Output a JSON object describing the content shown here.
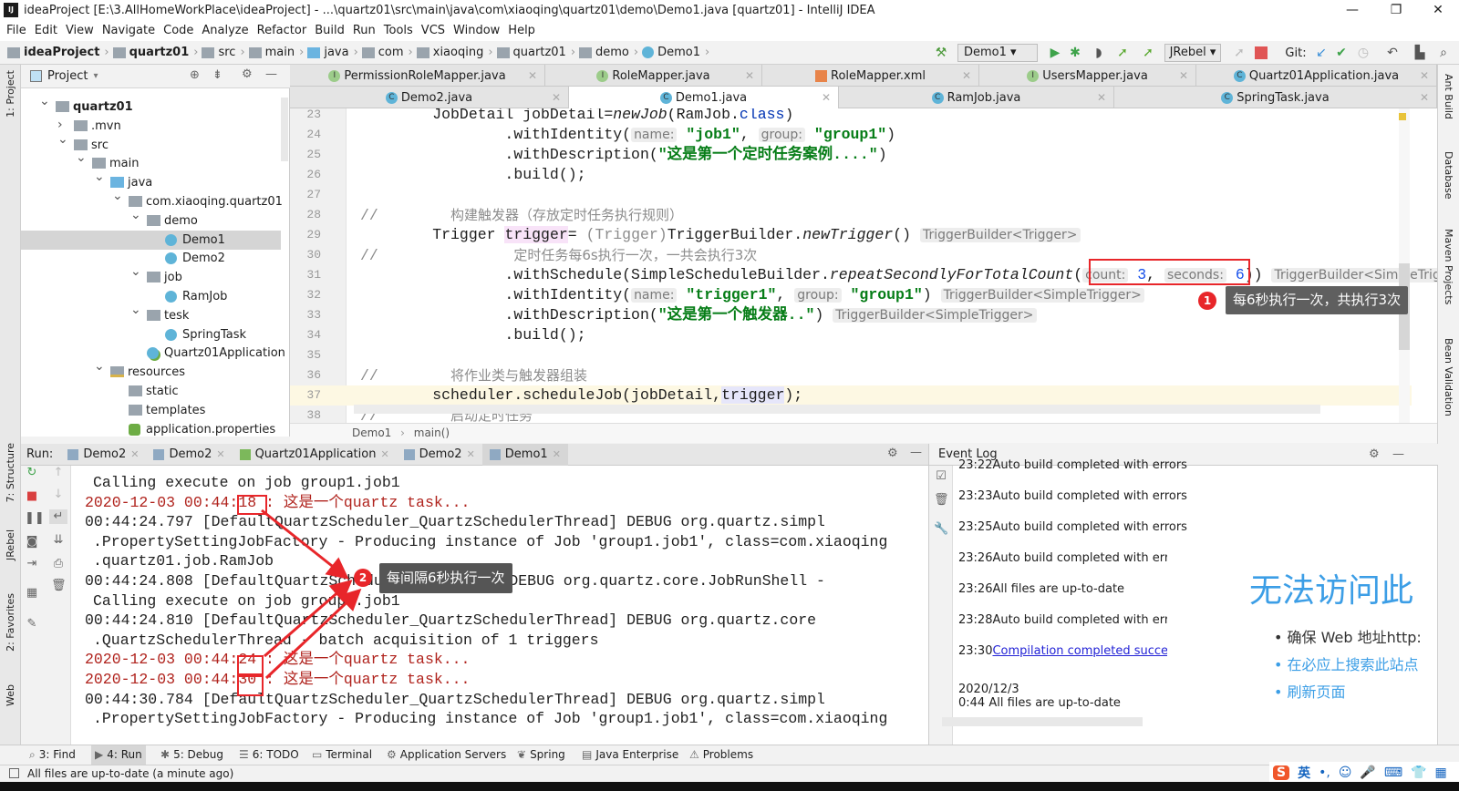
{
  "window": {
    "title": "ideaProject [E:\\3.AllHomeWorkPlace\\ideaProject] - ...\\quartz01\\src\\main\\java\\com\\xiaoqing\\quartz01\\demo\\Demo1.java [quartz01] - IntelliJ IDEA",
    "logo": "IJ",
    "minimize": "—",
    "maximize": "❐",
    "close": "✕"
  },
  "menu": [
    "File",
    "Edit",
    "View",
    "Navigate",
    "Code",
    "Analyze",
    "Refactor",
    "Build",
    "Run",
    "Tools",
    "VCS",
    "Window",
    "Help"
  ],
  "breadcrumb": [
    {
      "label": "ideaProject",
      "icon": "module",
      "bold": true
    },
    {
      "label": "quartz01",
      "icon": "module",
      "bold": true
    },
    {
      "label": "src",
      "icon": "folder"
    },
    {
      "label": "main",
      "icon": "folder"
    },
    {
      "label": "java",
      "icon": "source-folder"
    },
    {
      "label": "com",
      "icon": "package"
    },
    {
      "label": "xiaoqing",
      "icon": "package"
    },
    {
      "label": "quartz01",
      "icon": "package"
    },
    {
      "label": "demo",
      "icon": "package"
    },
    {
      "label": "Demo1",
      "icon": "class"
    }
  ],
  "toolbar": {
    "run_config": "Demo1",
    "jrebel": "JRebel",
    "git": "Git:"
  },
  "left_stripe": [
    "1: Project",
    "7: Structure",
    "JRebel",
    "2: Favorites",
    "Web"
  ],
  "right_stripe": [
    "Ant Build",
    "Database",
    "Maven Projects",
    "Bean Validation"
  ],
  "project": {
    "title": "Project",
    "tree": [
      {
        "label": "quartz01",
        "level": 0,
        "state": "expanded",
        "icon": "module",
        "bold": true
      },
      {
        "label": ".mvn",
        "level": 1,
        "state": "collapsed",
        "icon": "folder"
      },
      {
        "label": "src",
        "level": 1,
        "state": "expanded",
        "icon": "folder"
      },
      {
        "label": "main",
        "level": 2,
        "state": "expanded",
        "icon": "folder"
      },
      {
        "label": "java",
        "level": 3,
        "state": "expanded",
        "icon": "source-folder"
      },
      {
        "label": "com.xiaoqing.quartz01",
        "level": 4,
        "state": "expanded",
        "icon": "package"
      },
      {
        "label": "demo",
        "level": 5,
        "state": "expanded",
        "icon": "package"
      },
      {
        "label": "Demo1",
        "level": 6,
        "icon": "class",
        "selected": true
      },
      {
        "label": "Demo2",
        "level": 6,
        "icon": "class"
      },
      {
        "label": "job",
        "level": 5,
        "state": "expanded",
        "icon": "package"
      },
      {
        "label": "RamJob",
        "level": 6,
        "icon": "class"
      },
      {
        "label": "tesk",
        "level": 5,
        "state": "expanded",
        "icon": "package"
      },
      {
        "label": "SpringTask",
        "level": 6,
        "icon": "class"
      },
      {
        "label": "Quartz01Application",
        "level": 5,
        "icon": "spring-class"
      },
      {
        "label": "resources",
        "level": 3,
        "state": "expanded",
        "icon": "resources-folder"
      },
      {
        "label": "static",
        "level": 4,
        "icon": "folder"
      },
      {
        "label": "templates",
        "level": 4,
        "icon": "folder"
      },
      {
        "label": "application.properties",
        "level": 4,
        "icon": "properties"
      }
    ]
  },
  "editor_tabs_row1": [
    {
      "label": "PermissionRoleMapper.java",
      "icon": "I"
    },
    {
      "label": "RoleMapper.java",
      "icon": "I"
    },
    {
      "label": "RoleMapper.xml",
      "icon": "xml"
    },
    {
      "label": "UsersMapper.java",
      "icon": "I"
    },
    {
      "label": "Quartz01Application.java",
      "icon": "C"
    }
  ],
  "editor_tabs_row2": [
    {
      "label": "Demo2.java",
      "icon": "C"
    },
    {
      "label": "Demo1.java",
      "icon": "C",
      "active": true
    },
    {
      "label": "RamJob.java",
      "icon": "C"
    },
    {
      "label": "SpringTask.java",
      "icon": "C"
    }
  ],
  "code_lines": [
    {
      "n": "23",
      "tokens": [
        {
          "t": "        JobDetail jobDetail="
        },
        {
          "t": "newJob",
          "c": "it"
        },
        {
          "t": "(RamJob."
        },
        {
          "t": "class",
          "c": "kw"
        },
        {
          "t": ")"
        }
      ]
    },
    {
      "n": "24",
      "tokens": [
        {
          "t": "                .withIdentity("
        },
        {
          "t": "name:",
          "c": "hint"
        },
        {
          "t": " "
        },
        {
          "t": "\"job1\"",
          "c": "str"
        },
        {
          "t": ", "
        },
        {
          "t": "group:",
          "c": "hint"
        },
        {
          "t": " "
        },
        {
          "t": "\"group1\"",
          "c": "str"
        },
        {
          "t": ")"
        }
      ]
    },
    {
      "n": "25",
      "tokens": [
        {
          "t": "                .withDescription("
        },
        {
          "t": "\"这是第一个定时任务案例....\"",
          "c": "str"
        },
        {
          "t": ")"
        }
      ]
    },
    {
      "n": "26",
      "tokens": [
        {
          "t": "                .build();"
        }
      ]
    },
    {
      "n": "27",
      "tokens": []
    },
    {
      "n": "28",
      "tokens": [
        {
          "t": "//",
          "c": "cmm"
        },
        {
          "t": "        "
        },
        {
          "t": "构建触发器（存放定时任务执行规则）",
          "c": "cm"
        }
      ]
    },
    {
      "n": "29",
      "tokens": [
        {
          "t": "        Trigger "
        },
        {
          "t": "trigger",
          "c": "hl1"
        },
        {
          "t": "= "
        },
        {
          "t": "(Trigger)",
          "c": "gray"
        },
        {
          "t": "TriggerBuilder."
        },
        {
          "t": "newTrigger",
          "c": "it"
        },
        {
          "t": "() "
        },
        {
          "t": "TriggerBuilder<Trigger>",
          "c": "hint"
        }
      ]
    },
    {
      "n": "30",
      "tokens": [
        {
          "t": "//",
          "c": "cmm"
        },
        {
          "t": "               "
        },
        {
          "t": "定时任务每6s执行一次，一共会执行3次",
          "c": "cm"
        }
      ]
    },
    {
      "n": "31",
      "tokens": [
        {
          "t": "                .withSchedule(SimpleScheduleBuilder."
        },
        {
          "t": "repeatSecondlyForTotalCount",
          "c": "it"
        },
        {
          "t": "("
        },
        {
          "t": "count:",
          "c": "hint"
        },
        {
          "t": " "
        },
        {
          "t": "3",
          "c": "num"
        },
        {
          "t": ", "
        },
        {
          "t": "seconds:",
          "c": "hint"
        },
        {
          "t": " "
        },
        {
          "t": "6",
          "c": "num"
        },
        {
          "t": ")) "
        },
        {
          "t": "TriggerBuilder<SimpleTrigger>",
          "c": "hint"
        }
      ]
    },
    {
      "n": "32",
      "tokens": [
        {
          "t": "                .withIdentity("
        },
        {
          "t": "name:",
          "c": "hint"
        },
        {
          "t": " "
        },
        {
          "t": "\"trigger1\"",
          "c": "str"
        },
        {
          "t": ", "
        },
        {
          "t": "group:",
          "c": "hint"
        },
        {
          "t": " "
        },
        {
          "t": "\"group1\"",
          "c": "str"
        },
        {
          "t": ") "
        },
        {
          "t": "TriggerBuilder<SimpleTrigger>",
          "c": "hint"
        }
      ]
    },
    {
      "n": "33",
      "tokens": [
        {
          "t": "                .withDescription("
        },
        {
          "t": "\"这是第一个触发器..\"",
          "c": "str"
        },
        {
          "t": ") "
        },
        {
          "t": "TriggerBuilder<SimpleTrigger>",
          "c": "hint"
        }
      ]
    },
    {
      "n": "34",
      "tokens": [
        {
          "t": "                .build();"
        }
      ]
    },
    {
      "n": "35",
      "tokens": []
    },
    {
      "n": "36",
      "tokens": [
        {
          "t": "//",
          "c": "cmm"
        },
        {
          "t": "        "
        },
        {
          "t": "将作业类与触发器组装",
          "c": "cm"
        }
      ]
    },
    {
      "n": "37",
      "current": true,
      "tokens": [
        {
          "t": "        scheduler.scheduleJob(jobDetail,"
        },
        {
          "t": "trigger",
          "c": "hl2"
        },
        {
          "t": ");"
        }
      ]
    },
    {
      "n": "38",
      "tokens": [
        {
          "t": "//",
          "c": "cmm"
        },
        {
          "t": "        "
        },
        {
          "t": "启动定时任务",
          "c": "cm"
        }
      ]
    }
  ],
  "editor_breadcrumb": [
    "Demo1",
    "main()"
  ],
  "annotations": [
    {
      "number": "1",
      "text": "每6秒执行一次，共执行3次"
    },
    {
      "number": "2",
      "text": "每间隔6秒执行一次"
    }
  ],
  "run": {
    "label": "Run:",
    "tabs": [
      {
        "label": "Demo2"
      },
      {
        "label": "Demo2"
      },
      {
        "label": "Quartz01Application"
      },
      {
        "label": "Demo2"
      },
      {
        "label": "Demo1",
        "active": true
      }
    ],
    "console": [
      {
        "text": "Calling execute on job group1.job1",
        "indent": true
      },
      {
        "text": "2020-12-03 00:44:18 : 这是一个quartz task...",
        "error": true
      },
      {
        "text": "00:44:24.797 [DefaultQuartzScheduler_QuartzSchedulerThread] DEBUG org.quartz.simpl"
      },
      {
        "text": ".PropertySettingJobFactory - Producing instance of Job 'group1.job1', class=com.xiaoqing",
        "indent": true
      },
      {
        "text": ".quartz01.job.RamJob",
        "indent": true
      },
      {
        "text": "00:44:24.808 [DefaultQuartzScheduler_Worker-2] DEBUG org.quartz.core.JobRunShell -"
      },
      {
        "text": "Calling execute on job group1.job1",
        "indent": true
      },
      {
        "text": "00:44:24.810 [DefaultQuartzScheduler_QuartzSchedulerThread] DEBUG org.quartz.core"
      },
      {
        "text": ".QuartzSchedulerThread - batch acquisition of 1 triggers",
        "indent": true
      },
      {
        "text": "2020-12-03 00:44:24 : 这是一个quartz task...",
        "error": true
      },
      {
        "text": "2020-12-03 00:44:30 : 这是一个quartz task...",
        "error": true
      },
      {
        "text": "00:44:30.784 [DefaultQuartzScheduler_QuartzSchedulerThread] DEBUG org.quartz.simpl"
      },
      {
        "text": ".PropertySettingJobFactory - Producing instance of Job 'group1.job1', class=com.xiaoqing",
        "indent": true
      }
    ]
  },
  "event_log": {
    "title": "Event Log",
    "entries": [
      {
        "time": "23:22",
        "text": "Auto build completed with errors"
      },
      {
        "time": "23:23",
        "text": "Auto build completed with errors"
      },
      {
        "time": "23:25",
        "text": "Auto build completed with errors"
      },
      {
        "time": "23:26",
        "text": "Auto build completed with errors"
      },
      {
        "time": "23:26",
        "text": "All files are up-to-date"
      },
      {
        "time": "23:28",
        "text": "Auto build completed with errors"
      },
      {
        "time": "23:30",
        "text": "Compilation completed successfu",
        "link": true
      },
      {
        "date": "2020/12/3",
        "time": "0:44",
        "text": "All files are up-to-date"
      }
    ]
  },
  "browser_overlay": {
    "heading": "无法访问此",
    "items": [
      "确保 Web 地址http:",
      "在必应上搜索此站点",
      "刷新页面"
    ]
  },
  "bottom_tools": [
    {
      "label": "3: Find"
    },
    {
      "label": "4: Run",
      "active": true
    },
    {
      "label": "5: Debug"
    },
    {
      "label": "6: TODO"
    },
    {
      "label": "Terminal"
    },
    {
      "label": "Application Servers"
    },
    {
      "label": "Spring"
    },
    {
      "label": "Java Enterprise"
    },
    {
      "label": "Problems"
    }
  ],
  "status": "All files are up-to-date (a minute ago)",
  "ime": {
    "mode": "英"
  },
  "colors": {
    "annotation_red": "#e8262a",
    "console_error": "#b0231d",
    "string_green": "#067d17",
    "link_blue": "#2323d6",
    "browser_blue": "#3c9ee6"
  }
}
